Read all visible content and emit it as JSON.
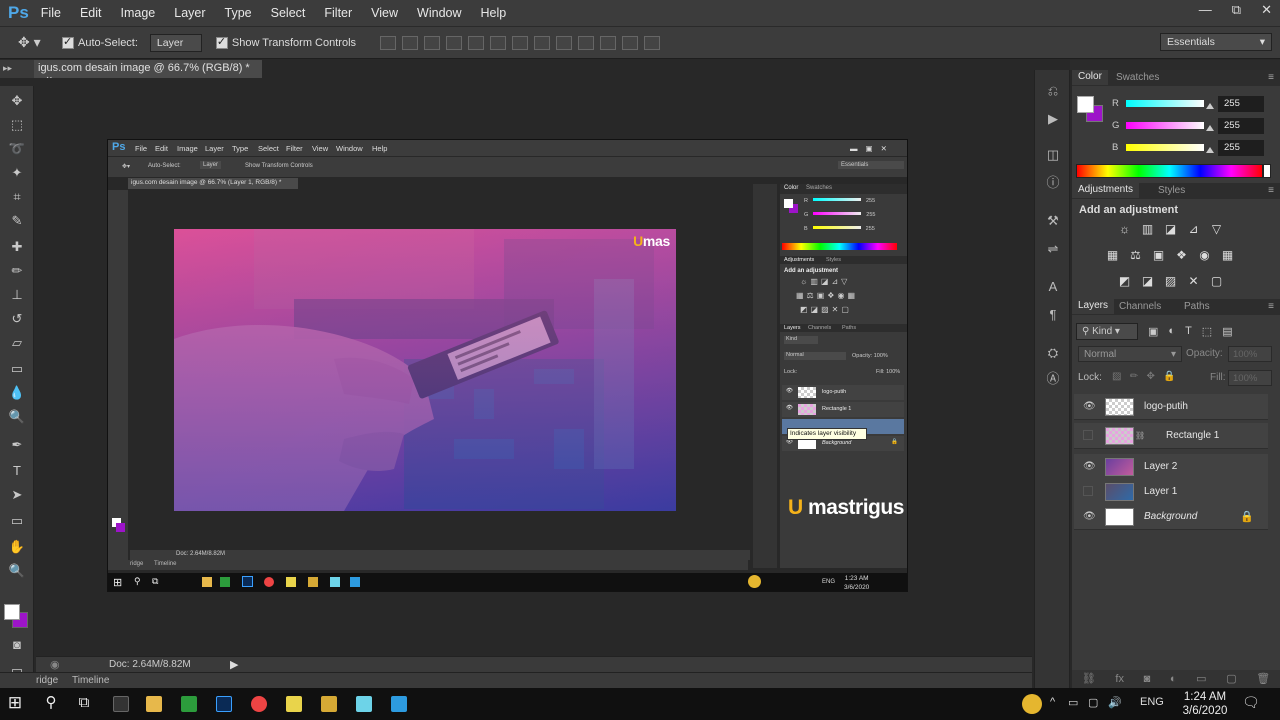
{
  "app": {
    "logo": "Ps",
    "menu": [
      "File",
      "Edit",
      "Image",
      "Layer",
      "Type",
      "Select",
      "Filter",
      "View",
      "Window",
      "Help"
    ],
    "window_controls": [
      "—",
      "⧉",
      "✕"
    ]
  },
  "options": {
    "auto_select_label": "Auto-Select:",
    "auto_select_value": "Layer",
    "show_transform_label": "Show Transform Controls",
    "workspace": "Essentials"
  },
  "document": {
    "tab_title": "igus.com desain image @ 66.7% (RGB/8) *",
    "tab_close": "×",
    "status_doc": "Doc: 2.64M/8.82M",
    "bottom_tabs": [
      "ridge",
      "Timeline"
    ]
  },
  "color_panel": {
    "tabs": [
      "Color",
      "Swatches"
    ],
    "channels": [
      {
        "label": "R",
        "value": "255"
      },
      {
        "label": "G",
        "value": "255"
      },
      {
        "label": "B",
        "value": "255"
      }
    ],
    "foreground": "#ffffff",
    "background": "#9d14c9"
  },
  "adjustments": {
    "tabs": [
      "Adjustments",
      "Styles"
    ],
    "title": "Add an adjustment"
  },
  "layers_panel": {
    "tabs": [
      "Layers",
      "Channels",
      "Paths"
    ],
    "kind": "Kind",
    "blend_mode": "Normal",
    "opacity_label": "Opacity:",
    "opacity_value": "100%",
    "lock_label": "Lock:",
    "fill_label": "Fill:",
    "fill_value": "100%",
    "layers": [
      {
        "name": "logo-putih",
        "visible": true,
        "italic": false
      },
      {
        "name": "Rectangle 1",
        "visible": false,
        "italic": false
      },
      {
        "name": "Layer 2",
        "visible": true,
        "italic": false
      },
      {
        "name": "Layer 1",
        "visible": false,
        "italic": false
      },
      {
        "name": "Background",
        "visible": true,
        "italic": true,
        "locked": true
      }
    ]
  },
  "embedded": {
    "doc_tab": "igus.com desain image @ 66.7% (Layer 1, RGB/8) *",
    "tooltip": "Indicates layer visibility",
    "status_doc": "Doc: 2.64M/8.82M",
    "bottom_tabs": [
      "ridge",
      "Timeline"
    ],
    "panel_tabs_color": [
      "Color",
      "Swatches"
    ],
    "panel_tabs_adjust": [
      "Adjustments",
      "Styles"
    ],
    "adjust_title": "Add an adjustment",
    "panel_tabs_layers": [
      "Layers",
      "Channels",
      "Paths"
    ],
    "kind": "Kind",
    "blend_mode": "Normal",
    "opacity_label": "Opacity:",
    "opacity_value": "100%",
    "lock_label": "Lock:",
    "fill_label": "Fill:",
    "fill_value": "100%",
    "layers": [
      "logo-putih",
      "Rectangle 1",
      "",
      "Background"
    ],
    "channel_values": [
      "255",
      "255",
      "255"
    ],
    "channel_labels": [
      "R",
      "G",
      "B"
    ],
    "clock_time": "1:23 AM",
    "clock_date": "3/6/2020",
    "lang": "ENG",
    "workspace": "Essentials",
    "auto_select_label": "Auto-Select:",
    "auto_select_value": "Layer",
    "show_transform_label": "Show Transform Controls"
  },
  "brand": {
    "prefix": "U",
    "name": "mastrigus",
    "photo_logo_prefix": "U",
    "photo_logo_name": "mas"
  },
  "taskbar": {
    "time": "1:24 AM",
    "date": "3/6/2020",
    "lang": "ENG"
  }
}
